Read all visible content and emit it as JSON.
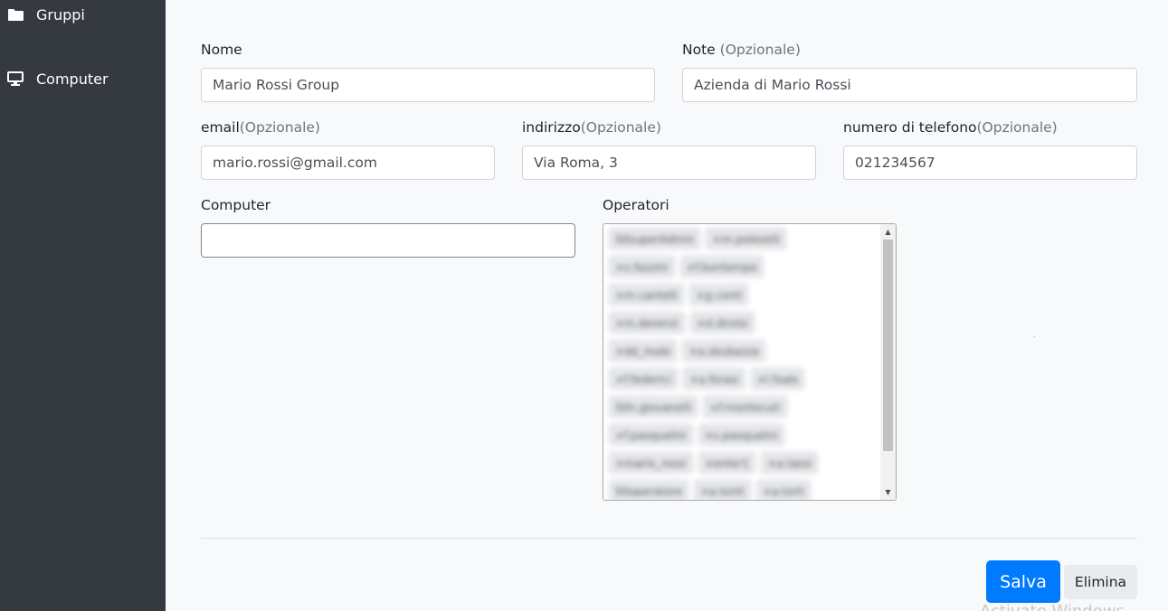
{
  "sidebar": {
    "items": [
      {
        "label": "Gruppi",
        "icon": "folder-icon"
      },
      {
        "label": "Computer",
        "icon": "monitor-icon"
      }
    ]
  },
  "form": {
    "name": {
      "label": "Nome",
      "value": "Mario Rossi Group"
    },
    "note": {
      "label": "Note",
      "optional": "(Opzionale)",
      "value": "Azienda di Mario Rossi"
    },
    "email": {
      "label": "email",
      "optional": "(Opzionale)",
      "value": "mario.rossi@gmail.com"
    },
    "address": {
      "label": "indirizzo",
      "optional": "(Opzionale)",
      "value": "Via Roma, 3"
    },
    "phone": {
      "label": "numero di telefono",
      "optional": "(Opzionale)",
      "value": "021234567"
    },
    "computer": {
      "label": "Computer",
      "value": ""
    },
    "operators": {
      "label": "Operatori",
      "rows": [
        [
          "S0superAdmin",
          "×m.poleselli"
        ],
        [
          "×s.fazzini",
          "×f.bontempo"
        ],
        [
          "×m.cantelli",
          "×g.conti"
        ],
        [
          "×m.derenzi",
          "×d.dirolsi"
        ],
        [
          "×dd_mobi",
          "×a.sbubazza"
        ],
        [
          "×f.federici",
          "×a.forasi",
          "×l.foals"
        ],
        [
          "S0n.giovanelli",
          "×f.montecuti"
        ],
        [
          "×f.pasqualini",
          "×s.pasqualini"
        ],
        [
          "×mario_rossi",
          "×enter1",
          "×a.tassi"
        ],
        [
          "S0operatore",
          "×a.tonti",
          "×a.torti"
        ]
      ]
    }
  },
  "actions": {
    "save": "Salva",
    "delete": "Elimina"
  },
  "watermark": "Activate Windows",
  "colors": {
    "sidebar": "#343a40",
    "primary": "#007bff",
    "background": "#f8f9fa"
  }
}
